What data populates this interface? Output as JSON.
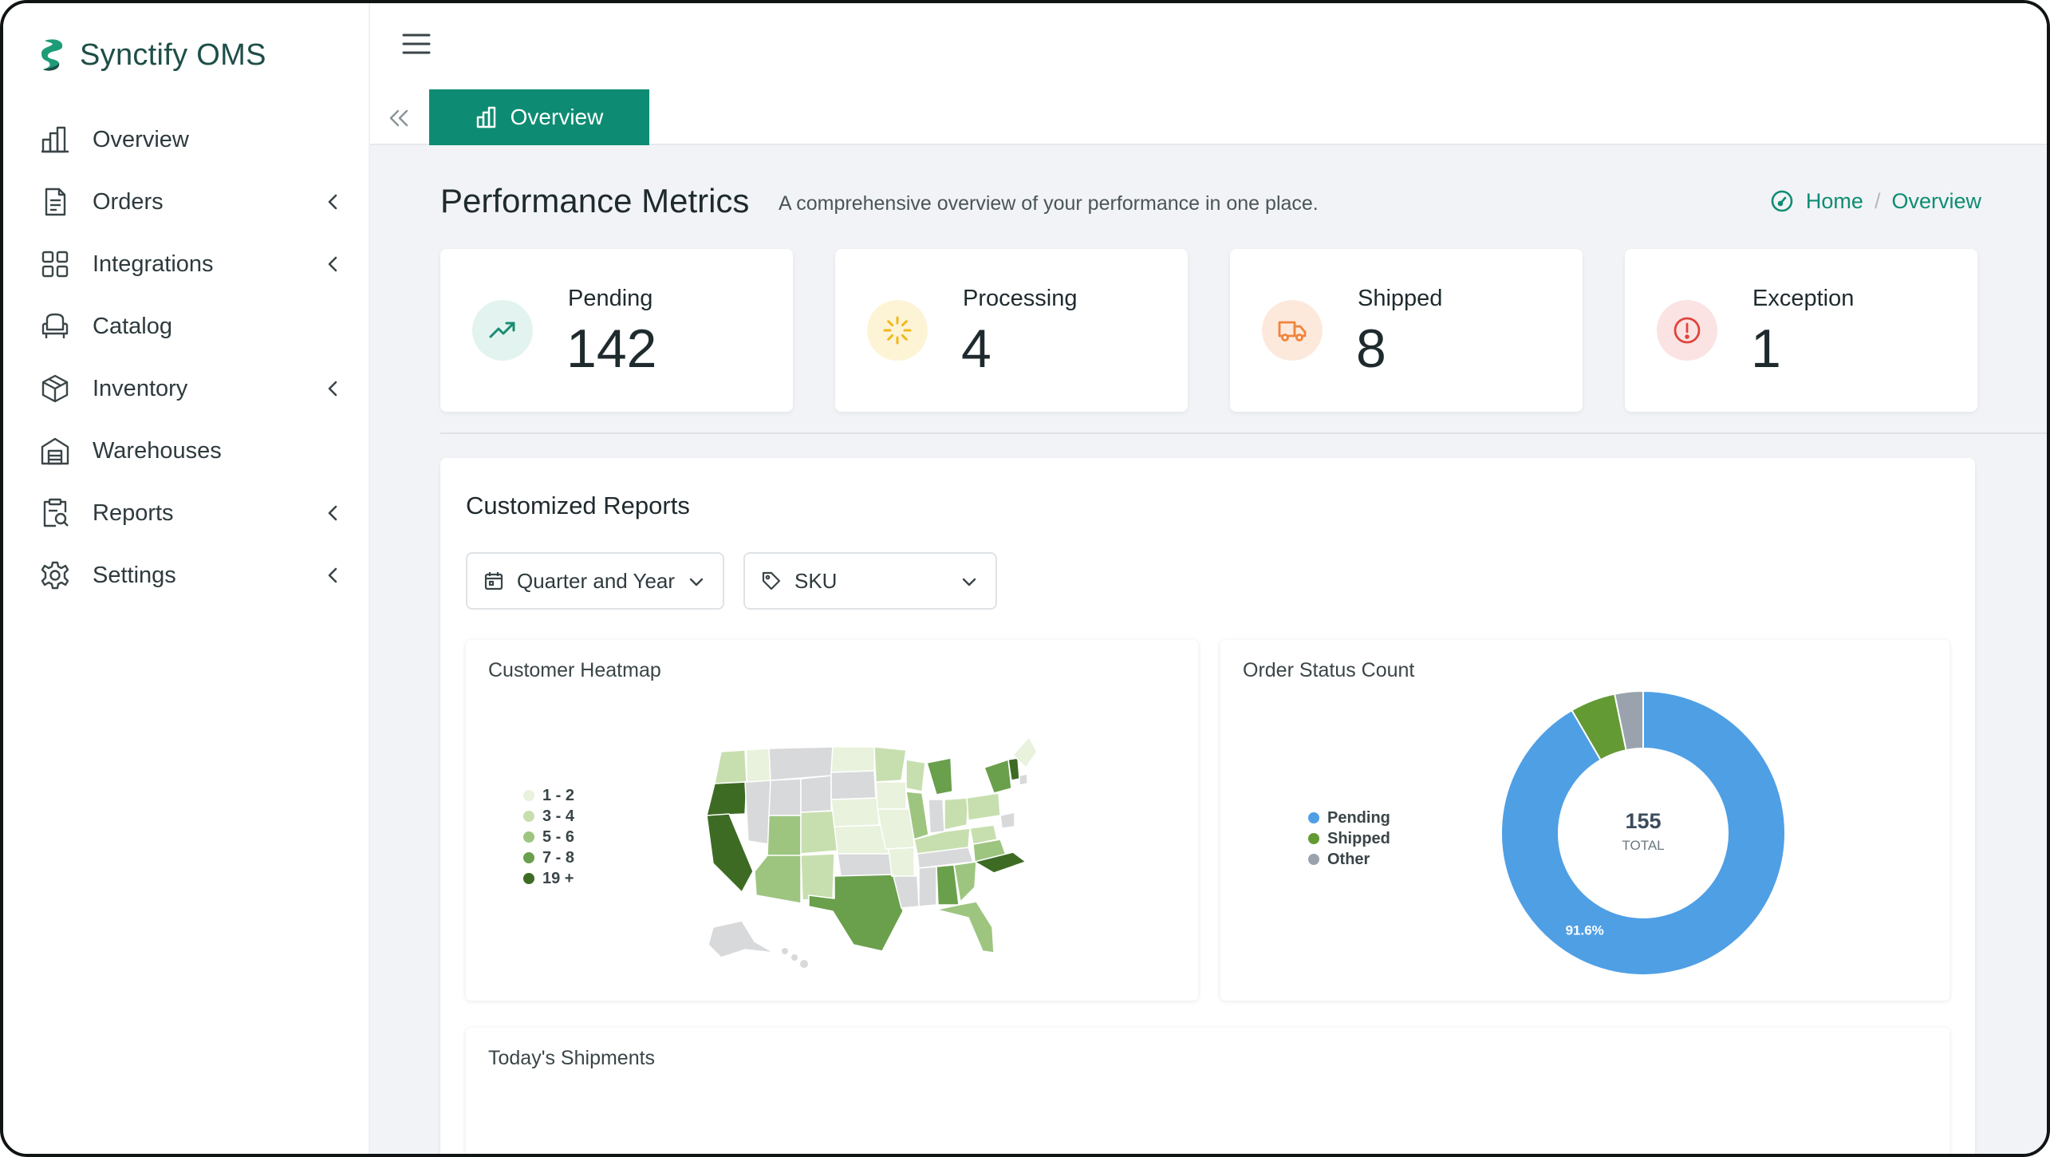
{
  "app": {
    "name": "Synctify OMS"
  },
  "sidebar": {
    "items": [
      {
        "label": "Overview",
        "icon": "bar-chart-icon",
        "has_submenu": false
      },
      {
        "label": "Orders",
        "icon": "document-icon",
        "has_submenu": true
      },
      {
        "label": "Integrations",
        "icon": "grid-icon",
        "has_submenu": true
      },
      {
        "label": "Catalog",
        "icon": "armchair-icon",
        "has_submenu": false
      },
      {
        "label": "Inventory",
        "icon": "box-icon",
        "has_submenu": true
      },
      {
        "label": "Warehouses",
        "icon": "warehouse-icon",
        "has_submenu": false
      },
      {
        "label": "Reports",
        "icon": "report-search-icon",
        "has_submenu": true
      },
      {
        "label": "Settings",
        "icon": "gear-icon",
        "has_submenu": true
      }
    ]
  },
  "tabs": [
    {
      "label": "Overview",
      "active": true
    }
  ],
  "header": {
    "title": "Performance Metrics",
    "subtitle": "A comprehensive overview of your performance in one place."
  },
  "breadcrumb": {
    "home": "Home",
    "current": "Overview"
  },
  "stats": [
    {
      "label": "Pending",
      "value": "142",
      "icon": "trend-up-icon",
      "color": "#1a8c74",
      "bg": "#e3f3ef"
    },
    {
      "label": "Processing",
      "value": "4",
      "icon": "loader-icon",
      "color": "#f1b71c",
      "bg": "#fdf4d6"
    },
    {
      "label": "Shipped",
      "value": "8",
      "icon": "truck-icon",
      "color": "#f0843c",
      "bg": "#fde9dc"
    },
    {
      "label": "Exception",
      "value": "1",
      "icon": "alert-icon",
      "color": "#e0443e",
      "bg": "#fbe3e3"
    }
  ],
  "reports": {
    "title": "Customized Reports",
    "filters": [
      {
        "label": "Quarter and Year",
        "icon": "calendar-icon"
      },
      {
        "label": "SKU",
        "icon": "tag-icon"
      }
    ],
    "heatmap": {
      "title": "Customer Heatmap",
      "legend": [
        {
          "label": "1 - 2",
          "color": "#e8f2dc"
        },
        {
          "label": "3 - 4",
          "color": "#c7dfae"
        },
        {
          "label": "5 - 6",
          "color": "#9dc580"
        },
        {
          "label": "7 - 8",
          "color": "#6a9f4c"
        },
        {
          "label": "19 +",
          "color": "#3d6b24"
        }
      ]
    },
    "order_status": {
      "title": "Order Status Count"
    },
    "shipments": {
      "title": "Today's Shipments"
    }
  },
  "chart_data": {
    "type": "pie",
    "title": "Order Status Count",
    "categories": [
      "Pending",
      "Shipped",
      "Other"
    ],
    "values": [
      142,
      8,
      5
    ],
    "colors": [
      "#4f9fe5",
      "#649a34",
      "#9aa3ad"
    ],
    "total": 155,
    "total_label": "TOTAL",
    "slice_label": "91.6%",
    "donut": true,
    "legend_position": "left"
  }
}
